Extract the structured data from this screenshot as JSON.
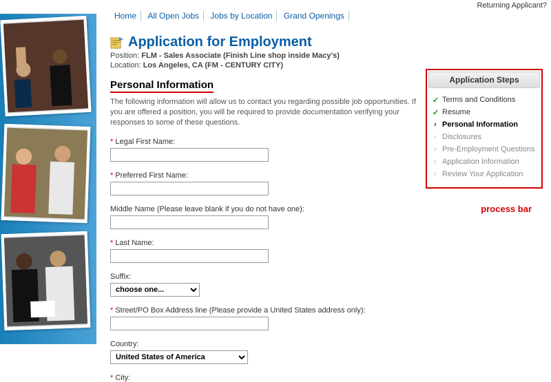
{
  "top_right": {
    "label": "Returning Applicant?"
  },
  "nav": {
    "home": "Home",
    "all_open": "All Open Jobs",
    "by_location": "Jobs by Location",
    "grand": "Grand Openings"
  },
  "page": {
    "title": "Application for Employment",
    "position_prefix": "Position: ",
    "position": "FLM - Sales Associate (Finish Line shop inside Macy's)",
    "location_prefix": "Location: ",
    "location": "Los Angeles, CA  (FM - CENTURY CITY)"
  },
  "section": {
    "heading": "Personal Information",
    "desc": "The following information will allow us to contact you regarding possible job opportunities. If you are offered a position, you will be required to provide documentation verifying your responses to some of these questions."
  },
  "fields": {
    "legal_first": {
      "label": "Legal First Name:",
      "value": ""
    },
    "pref_first": {
      "label": "Preferred First Name:",
      "value": ""
    },
    "middle": {
      "label": "Middle Name (Please leave blank if you do not have one):",
      "value": ""
    },
    "last": {
      "label": "Last Name:",
      "value": ""
    },
    "suffix": {
      "label": "Suffix:",
      "value": "choose one..."
    },
    "street": {
      "label": "Street/PO Box Address line (Please provide a United States address only):",
      "value": ""
    },
    "country": {
      "label": "Country:",
      "value": "United States of America"
    },
    "city": {
      "label": "City:",
      "value": ""
    }
  },
  "steps": {
    "title": "Application Steps",
    "items": [
      {
        "label": "Terms and Conditions",
        "state": "done"
      },
      {
        "label": "Resume",
        "state": "done"
      },
      {
        "label": "Personal Information",
        "state": "current"
      },
      {
        "label": "Disclosures",
        "state": "pending"
      },
      {
        "label": "Pre-Employment Questions",
        "state": "pending"
      },
      {
        "label": "Application Information",
        "state": "pending"
      },
      {
        "label": "Review Your Application",
        "state": "pending"
      }
    ]
  },
  "annotation": {
    "process_bar": "process bar"
  }
}
